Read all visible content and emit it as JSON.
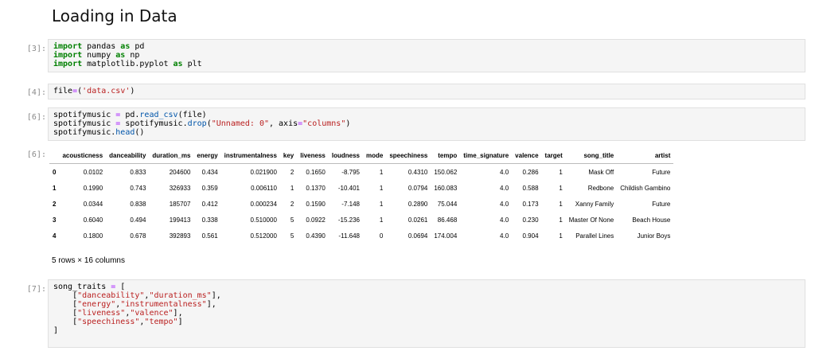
{
  "heading": "Loading in Data",
  "cells": {
    "c3": {
      "prompt": "[3]:",
      "lines": [
        [
          {
            "t": "import",
            "c": "kw"
          },
          {
            "t": " pandas "
          },
          {
            "t": "as",
            "c": "kw"
          },
          {
            "t": " pd"
          }
        ],
        [
          {
            "t": "import",
            "c": "kw"
          },
          {
            "t": " numpy "
          },
          {
            "t": "as",
            "c": "kw"
          },
          {
            "t": " np"
          }
        ],
        [
          {
            "t": "import",
            "c": "kw"
          },
          {
            "t": " matplotlib.pyplot "
          },
          {
            "t": "as",
            "c": "kw"
          },
          {
            "t": " plt"
          }
        ]
      ]
    },
    "c4": {
      "prompt": "[4]:",
      "lines": [
        [
          {
            "t": "file"
          },
          {
            "t": "=",
            "c": "op"
          },
          {
            "t": "("
          },
          {
            "t": "'data.csv'",
            "c": "str"
          },
          {
            "t": ")"
          }
        ]
      ]
    },
    "c6": {
      "prompt": "[6]:",
      "lines": [
        [
          {
            "t": "spotifymusic "
          },
          {
            "t": "=",
            "c": "op"
          },
          {
            "t": " pd"
          },
          {
            "t": "."
          },
          {
            "t": "read_csv",
            "c": "fn"
          },
          {
            "t": "(file)"
          }
        ],
        [
          {
            "t": "spotifymusic "
          },
          {
            "t": "=",
            "c": "op"
          },
          {
            "t": " spotifymusic"
          },
          {
            "t": "."
          },
          {
            "t": "drop",
            "c": "fn"
          },
          {
            "t": "("
          },
          {
            "t": "\"Unnamed: 0\"",
            "c": "str"
          },
          {
            "t": ", axis"
          },
          {
            "t": "=",
            "c": "op"
          },
          {
            "t": "\"columns\"",
            "c": "str"
          },
          {
            "t": ")"
          }
        ],
        [
          {
            "t": "spotifymusic"
          },
          {
            "t": "."
          },
          {
            "t": "head",
            "c": "fn"
          },
          {
            "t": "()"
          }
        ]
      ]
    },
    "out6": {
      "prompt": "[6]:",
      "columns": [
        "",
        "acousticness",
        "danceability",
        "duration_ms",
        "energy",
        "instrumentalness",
        "key",
        "liveness",
        "loudness",
        "mode",
        "speechiness",
        "tempo",
        "time_signature",
        "valence",
        "target",
        "song_title",
        "artist"
      ],
      "rows": [
        [
          "0",
          "0.0102",
          "0.833",
          "204600",
          "0.434",
          "0.021900",
          "2",
          "0.1650",
          "-8.795",
          "1",
          "0.4310",
          "150.062",
          "4.0",
          "0.286",
          "1",
          "Mask Off",
          "Future"
        ],
        [
          "1",
          "0.1990",
          "0.743",
          "326933",
          "0.359",
          "0.006110",
          "1",
          "0.1370",
          "-10.401",
          "1",
          "0.0794",
          "160.083",
          "4.0",
          "0.588",
          "1",
          "Redbone",
          "Childish Gambino"
        ],
        [
          "2",
          "0.0344",
          "0.838",
          "185707",
          "0.412",
          "0.000234",
          "2",
          "0.1590",
          "-7.148",
          "1",
          "0.2890",
          "75.044",
          "4.0",
          "0.173",
          "1",
          "Xanny Family",
          "Future"
        ],
        [
          "3",
          "0.6040",
          "0.494",
          "199413",
          "0.338",
          "0.510000",
          "5",
          "0.0922",
          "-15.236",
          "1",
          "0.0261",
          "86.468",
          "4.0",
          "0.230",
          "1",
          "Master Of None",
          "Beach House"
        ],
        [
          "4",
          "0.1800",
          "0.678",
          "392893",
          "0.561",
          "0.512000",
          "5",
          "0.4390",
          "-11.648",
          "0",
          "0.0694",
          "174.004",
          "4.0",
          "0.904",
          "1",
          "Parallel Lines",
          "Junior Boys"
        ]
      ],
      "shape": "5 rows × 16 columns"
    },
    "c7": {
      "prompt": "[7]:",
      "lines": [
        [
          {
            "t": "song_traits "
          },
          {
            "t": "=",
            "c": "op"
          },
          {
            "t": " ["
          }
        ],
        [
          {
            "t": "    ["
          },
          {
            "t": "\"danceability\"",
            "c": "str"
          },
          {
            "t": ","
          },
          {
            "t": "\"duration_ms\"",
            "c": "str"
          },
          {
            "t": "],"
          }
        ],
        [
          {
            "t": "    ["
          },
          {
            "t": "\"energy\"",
            "c": "str"
          },
          {
            "t": ","
          },
          {
            "t": "\"instrumentalness\"",
            "c": "str"
          },
          {
            "t": "],"
          }
        ],
        [
          {
            "t": "    ["
          },
          {
            "t": "\"liveness\"",
            "c": "str"
          },
          {
            "t": ","
          },
          {
            "t": "\"valence\"",
            "c": "str"
          },
          {
            "t": "],"
          }
        ],
        [
          {
            "t": "    ["
          },
          {
            "t": "\"speechiness\"",
            "c": "str"
          },
          {
            "t": ","
          },
          {
            "t": "\"tempo\"",
            "c": "str"
          },
          {
            "t": "]"
          }
        ],
        [
          {
            "t": "]"
          }
        ]
      ]
    }
  }
}
